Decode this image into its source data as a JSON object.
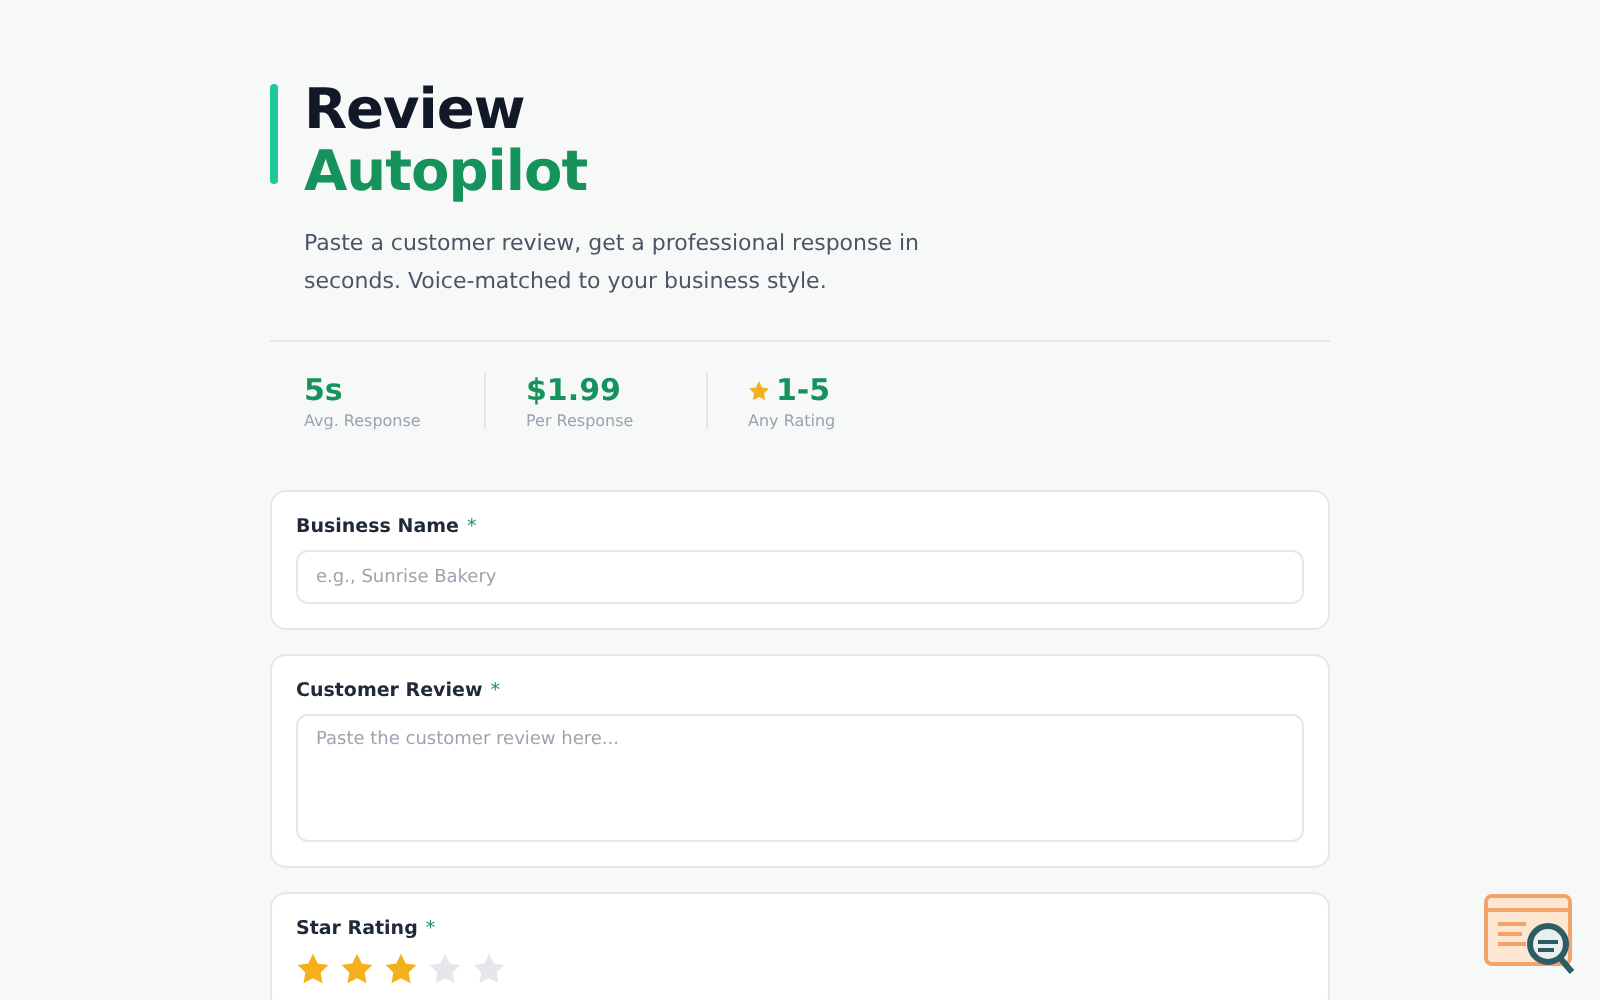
{
  "header": {
    "title_line_1": "Review",
    "title_line_2": "Autopilot",
    "subtitle": "Paste a customer review, get a professional response in seconds. Voice-matched to your business style."
  },
  "stats": [
    {
      "kind": "plain",
      "value": "5s",
      "label": "Avg. Response"
    },
    {
      "kind": "plain",
      "value": "$1.99",
      "label": "Per Response"
    },
    {
      "kind": "star",
      "value": "1-5",
      "label": "Any Rating"
    }
  ],
  "form": [
    {
      "kind": "input",
      "label": "Business Name",
      "required": "*",
      "placeholder": "e.g., Sunrise Bakery"
    },
    {
      "kind": "textarea",
      "label": "Customer Review",
      "required": "*",
      "placeholder": "Paste the customer review here..."
    },
    {
      "kind": "stars",
      "label": "Star Rating",
      "required": "*",
      "stars": 3
    }
  ]
}
